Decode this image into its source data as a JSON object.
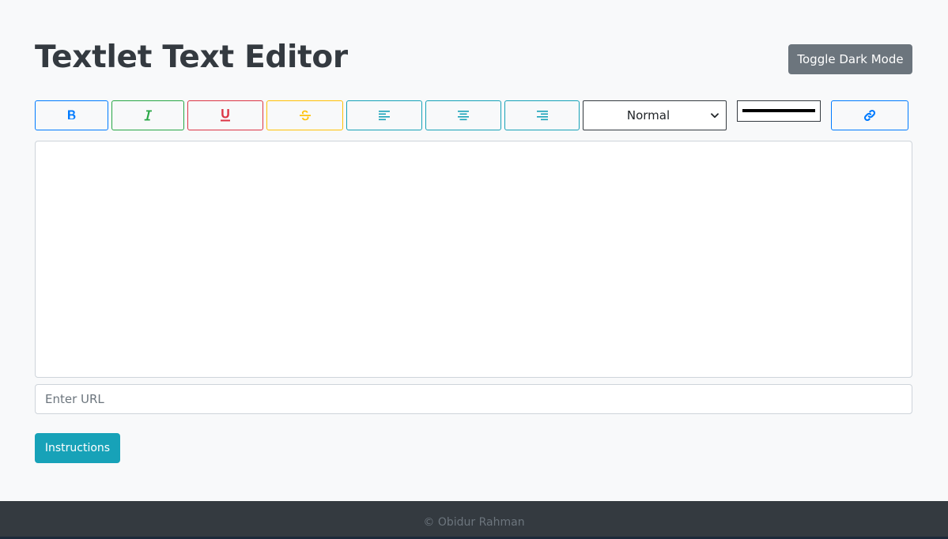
{
  "header": {
    "title": "Textlet Text Editor",
    "dark_mode_label": "Toggle Dark Mode"
  },
  "toolbar": {
    "buttons": [
      {
        "name": "bold",
        "icon": "bold-icon",
        "color": "#007bff"
      },
      {
        "name": "italic",
        "icon": "italic-icon",
        "color": "#28a745"
      },
      {
        "name": "underline",
        "icon": "underline-icon",
        "color": "#dc3545"
      },
      {
        "name": "strikethrough",
        "icon": "strikethrough-icon",
        "color": "#ffc107"
      },
      {
        "name": "align-left",
        "icon": "align-left-icon",
        "color": "#17a2b8"
      },
      {
        "name": "align-center",
        "icon": "align-center-icon",
        "color": "#17a2b8"
      },
      {
        "name": "align-right",
        "icon": "align-right-icon",
        "color": "#17a2b8"
      },
      {
        "name": "link",
        "icon": "link-icon",
        "color": "#007bff"
      }
    ],
    "font_size": {
      "selected": "Normal"
    },
    "text_color": "#000000"
  },
  "editor": {
    "content": ""
  },
  "url_input": {
    "placeholder": "Enter URL",
    "value": ""
  },
  "instructions_label": "Instructions",
  "footer": {
    "text": "© Obidur Rahman"
  },
  "colors": {
    "background": "#f8f9fa",
    "secondary": "#6c757d",
    "info": "#17a2b8",
    "primary": "#007bff",
    "success": "#28a745",
    "danger": "#dc3545",
    "warning": "#ffc107",
    "dark": "#343a40"
  }
}
